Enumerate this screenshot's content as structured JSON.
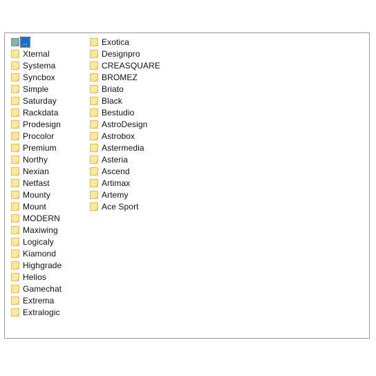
{
  "window": {
    "background_color": "#ffffff"
  },
  "file_panel": {
    "border_color": "#9a9a9a",
    "background_color": "#ffffff",
    "folder_icon_color": "#fce8a0",
    "folder_icon_border_color": "#e3c14c",
    "parent_icon_color": "#89b0ae",
    "selection_color": "#1570c9",
    "columns": [
      {
        "items": [
          {
            "label": "..",
            "icon": "folder-parent-icon",
            "selected": true
          },
          {
            "label": "Xternal",
            "icon": "folder-icon",
            "selected": false
          },
          {
            "label": "Systema",
            "icon": "folder-icon",
            "selected": false
          },
          {
            "label": "Syncbox",
            "icon": "folder-icon",
            "selected": false
          },
          {
            "label": "Simple",
            "icon": "folder-icon",
            "selected": false
          },
          {
            "label": "Saturday",
            "icon": "folder-icon",
            "selected": false
          },
          {
            "label": "Rackdata",
            "icon": "folder-icon",
            "selected": false
          },
          {
            "label": "Prodesign",
            "icon": "folder-icon",
            "selected": false
          },
          {
            "label": "Procolor",
            "icon": "folder-icon",
            "selected": false
          },
          {
            "label": "Premium",
            "icon": "folder-icon",
            "selected": false
          },
          {
            "label": "Northy",
            "icon": "folder-icon",
            "selected": false
          },
          {
            "label": "Nexian",
            "icon": "folder-icon",
            "selected": false
          },
          {
            "label": "Netfast",
            "icon": "folder-icon",
            "selected": false
          },
          {
            "label": "Mounty",
            "icon": "folder-icon",
            "selected": false
          },
          {
            "label": "Mount",
            "icon": "folder-icon",
            "selected": false
          },
          {
            "label": "MODERN",
            "icon": "folder-icon",
            "selected": false
          },
          {
            "label": "Maxiwing",
            "icon": "folder-icon",
            "selected": false
          },
          {
            "label": "Logicaly",
            "icon": "folder-icon",
            "selected": false
          },
          {
            "label": "Kiamond",
            "icon": "folder-icon",
            "selected": false
          },
          {
            "label": "Highgrade",
            "icon": "folder-icon",
            "selected": false
          },
          {
            "label": "Helios",
            "icon": "folder-icon",
            "selected": false
          },
          {
            "label": "Gamechat",
            "icon": "folder-icon",
            "selected": false
          },
          {
            "label": "Extrema",
            "icon": "folder-icon",
            "selected": false
          },
          {
            "label": "Extralogic",
            "icon": "folder-icon",
            "selected": false
          }
        ]
      },
      {
        "items": [
          {
            "label": "Exotica",
            "icon": "folder-icon",
            "selected": false
          },
          {
            "label": "Designpro",
            "icon": "folder-icon",
            "selected": false
          },
          {
            "label": "CREASQUARE",
            "icon": "folder-icon",
            "selected": false
          },
          {
            "label": "BROMEZ",
            "icon": "folder-icon",
            "selected": false
          },
          {
            "label": "Briato",
            "icon": "folder-icon",
            "selected": false
          },
          {
            "label": "Black",
            "icon": "folder-icon",
            "selected": false
          },
          {
            "label": "Bestudio",
            "icon": "folder-icon",
            "selected": false
          },
          {
            "label": "AstroDesign",
            "icon": "folder-icon",
            "selected": false
          },
          {
            "label": "Astrobox",
            "icon": "folder-icon",
            "selected": false
          },
          {
            "label": "Astermedia",
            "icon": "folder-icon",
            "selected": false
          },
          {
            "label": "Asteria",
            "icon": "folder-icon",
            "selected": false
          },
          {
            "label": "Ascend",
            "icon": "folder-icon",
            "selected": false
          },
          {
            "label": "Artimax",
            "icon": "folder-icon",
            "selected": false
          },
          {
            "label": "Artemy",
            "icon": "folder-icon",
            "selected": false
          },
          {
            "label": "Ace Sport",
            "icon": "folder-icon",
            "selected": false
          }
        ]
      }
    ]
  }
}
